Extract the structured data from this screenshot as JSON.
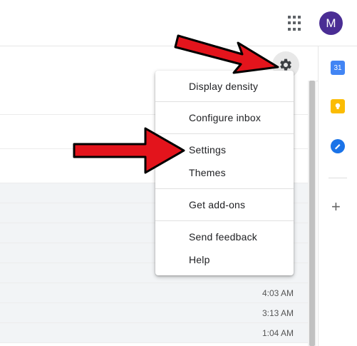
{
  "header": {
    "avatar_letter": "M"
  },
  "settings_menu": {
    "items": [
      {
        "label": "Display density"
      },
      {
        "label": "Configure inbox"
      },
      {
        "label": "Settings"
      },
      {
        "label": "Themes"
      },
      {
        "label": "Get add-ons"
      },
      {
        "label": "Send feedback"
      },
      {
        "label": "Help"
      }
    ]
  },
  "email_list": {
    "times": [
      "4:03 AM",
      "3:13 AM",
      "1:04 AM"
    ]
  },
  "side_panel": {
    "calendar_label": "31"
  },
  "colors": {
    "avatar": "#4a2d94",
    "arrow_fill": "#e3141c",
    "arrow_outline": "#000000",
    "calendar_blue": "#4285f4",
    "keep_yellow": "#fbbc04",
    "tasks_blue": "#1a73e8"
  }
}
